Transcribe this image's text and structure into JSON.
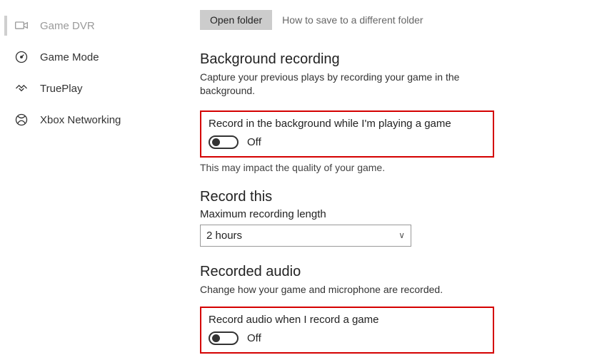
{
  "sidebar": {
    "items": [
      {
        "label": "Game DVR"
      },
      {
        "label": "Game Mode"
      },
      {
        "label": "TruePlay"
      },
      {
        "label": "Xbox Networking"
      }
    ]
  },
  "top": {
    "open_folder": "Open folder",
    "save_hint": "How to save to a different folder"
  },
  "bg": {
    "heading": "Background recording",
    "desc": "Capture your previous plays by recording your game in the background.",
    "toggle_label": "Record in the background while I'm playing a game",
    "toggle_state": "Off",
    "note": "This may impact the quality of your game."
  },
  "record_this": {
    "heading": "Record this",
    "length_label": "Maximum recording length",
    "length_value": "2 hours"
  },
  "audio": {
    "heading": "Recorded audio",
    "desc": "Change how your game and microphone are recorded.",
    "toggle_label": "Record audio when I record a game",
    "toggle_state": "Off"
  }
}
